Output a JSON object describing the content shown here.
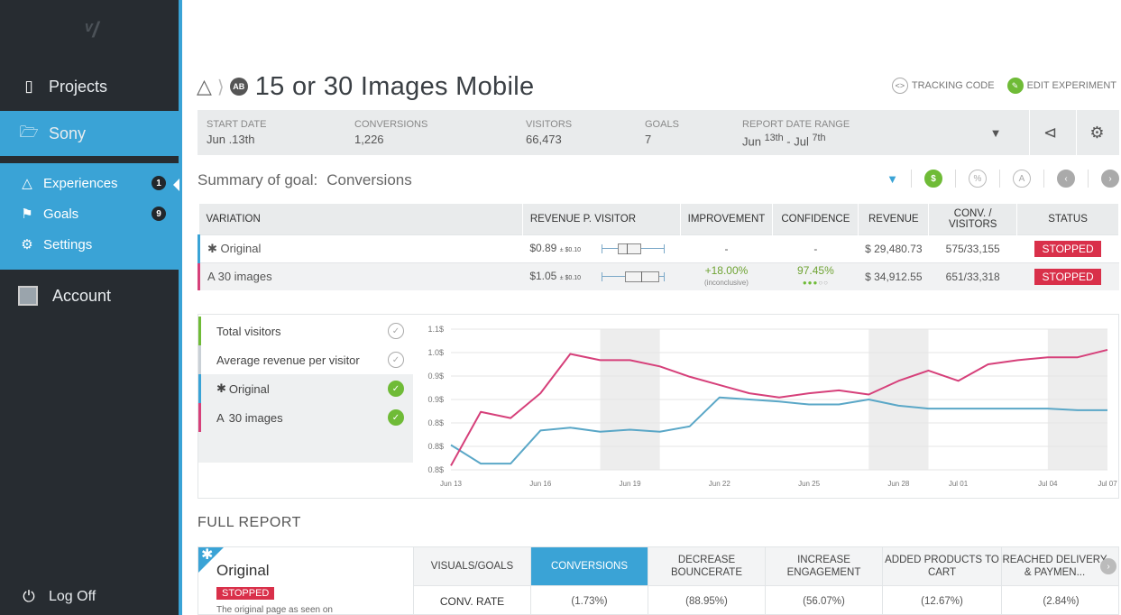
{
  "sidebar": {
    "logo": "ᵛ/",
    "projects_label": "Projects",
    "sony_label": "Sony",
    "experiences_label": "Experiences",
    "experiences_count": "1",
    "goals_label": "Goals",
    "goals_count": "9",
    "settings_label": "Settings",
    "account_label": "Account",
    "logoff_label": "Log Off"
  },
  "header": {
    "ab_badge": "AB",
    "title": "15 or 30 Images Mobile",
    "tracking_code": "TRACKING CODE",
    "edit_experiment": "EDIT EXPERIMENT"
  },
  "stats": {
    "start_date_label": "START DATE",
    "start_date": "Jun .13th",
    "conversions_label": "CONVERSIONS",
    "conversions": "1,226",
    "visitors_label": "VISITORS",
    "visitors": "66,473",
    "goals_label": "GOALS",
    "goals": "7",
    "range_label": "REPORT DATE RANGE",
    "range_from": "Jun",
    "range_from_sup": "13th",
    "range_sep": "- Jul",
    "range_to_sup": "7th"
  },
  "summary": {
    "prefix": "Summary of goal:",
    "goal": "Conversions",
    "btn_dollar": "$",
    "btn_percent": "%",
    "btn_a": "A"
  },
  "variations": {
    "headers": [
      "VARIATION",
      "REVENUE P. VISITOR",
      "IMPROVEMENT",
      "CONFIDENCE",
      "REVENUE",
      "CONV. / VISITORS",
      "STATUS"
    ],
    "rows": [
      {
        "prefix": "✱",
        "name": "Original",
        "color": "#3aa3d6",
        "rpv": "$0.89",
        "rpv_err": "± $0.10",
        "improvement": "-",
        "improvement_note": "",
        "confidence": "-",
        "revenue": "$ 29,480.73",
        "conv": "575/33,155",
        "status": "STOPPED"
      },
      {
        "prefix": "A",
        "name": "30 images",
        "color": "#d6407a",
        "rpv": "$1.05",
        "rpv_err": "± $0.10",
        "improvement": "+18.00%",
        "improvement_note": "(inconclusive)",
        "confidence": "97.45%",
        "revenue": "$ 34,912.55",
        "conv": "651/33,318",
        "status": "STOPPED"
      }
    ]
  },
  "legend": {
    "total_visitors": "Total visitors",
    "avg_revenue": "Average revenue per visitor",
    "original_prefix": "✱",
    "original": "Original",
    "variant_prefix": "A",
    "variant": "30 images"
  },
  "chart_data": {
    "type": "line",
    "x": [
      "Jun 13",
      "Jun 14",
      "Jun 15",
      "Jun 16",
      "Jun 17",
      "Jun 18",
      "Jun 19",
      "Jun 20",
      "Jun 21",
      "Jun 22",
      "Jun 23",
      "Jun 24",
      "Jun 25",
      "Jun 26",
      "Jun 27",
      "Jun 28",
      "Jun 29",
      "Jul 01",
      "Jul 02",
      "Jul 03",
      "Jul 04",
      "Jul 05",
      "Jul 07"
    ],
    "x_tick_labels": [
      "Jun 13",
      "Jun 16",
      "Jun 19",
      "Jun 22",
      "Jun 25",
      "Jun 28",
      "Jul 01",
      "Jul 04",
      "Jul 07"
    ],
    "y_tick_labels": [
      "0.8$",
      "0.8$",
      "0.8$",
      "0.9$",
      "0.9$",
      "1.0$",
      "1.1$"
    ],
    "ylim": [
      0.78,
      1.12
    ],
    "series": [
      {
        "name": "Original",
        "color": "#5aa7c7",
        "values": [
          0.84,
          0.795,
          0.795,
          0.875,
          0.882,
          0.872,
          0.877,
          0.872,
          0.885,
          0.955,
          0.95,
          0.945,
          0.938,
          0.938,
          0.95,
          0.935,
          0.928,
          0.928,
          0.928,
          0.928,
          0.928,
          0.924,
          0.924
        ]
      },
      {
        "name": "30 images",
        "color": "#d6407a",
        "values": [
          0.79,
          0.92,
          0.905,
          0.965,
          1.06,
          1.045,
          1.045,
          1.03,
          1.005,
          0.985,
          0.965,
          0.955,
          0.965,
          0.972,
          0.962,
          0.995,
          1.02,
          0.995,
          1.035,
          1.045,
          1.052,
          1.052,
          1.07
        ]
      }
    ]
  },
  "full_report": {
    "title": "FULL REPORT",
    "variation": "Original",
    "status": "STOPPED",
    "description": "The original page as seen on",
    "row_label": "CONV. RATE",
    "visuals_goals": "VISUALS/GOALS",
    "columns": [
      {
        "label": "CONVERSIONS",
        "value": "(1.73%)"
      },
      {
        "label": "DECREASE BOUNCERATE",
        "value": "(88.95%)"
      },
      {
        "label": "INCREASE ENGAGEMENT",
        "value": "(56.07%)"
      },
      {
        "label": "ADDED PRODUCTS TO CART",
        "value": "(12.67%)"
      },
      {
        "label": "REACHED DELIVERY & PAYMEN...",
        "value": "(2.84%)"
      }
    ]
  },
  "colors": {
    "accent": "#3aa3d6",
    "sidebar": "#272c31",
    "stopped": "#d9304a",
    "success": "#6fbb37"
  }
}
